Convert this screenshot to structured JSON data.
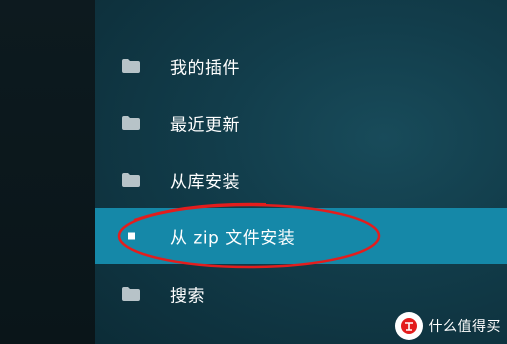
{
  "menu": {
    "items": [
      {
        "label": "我的插件",
        "icon": "folder-icon",
        "selected": false
      },
      {
        "label": "最近更新",
        "icon": "folder-icon",
        "selected": false
      },
      {
        "label": "从库安装",
        "icon": "folder-icon",
        "selected": false
      },
      {
        "label": "从 zip 文件安装",
        "icon": "selection-square-icon",
        "selected": true
      },
      {
        "label": "搜索",
        "icon": "folder-icon",
        "selected": false
      }
    ]
  },
  "watermark": {
    "text": "什么值得买",
    "logo_text": "值"
  },
  "colors": {
    "selected_bg": "#1588a8",
    "annotation": "#e31d1d",
    "panel_bg": "#123d4b"
  }
}
